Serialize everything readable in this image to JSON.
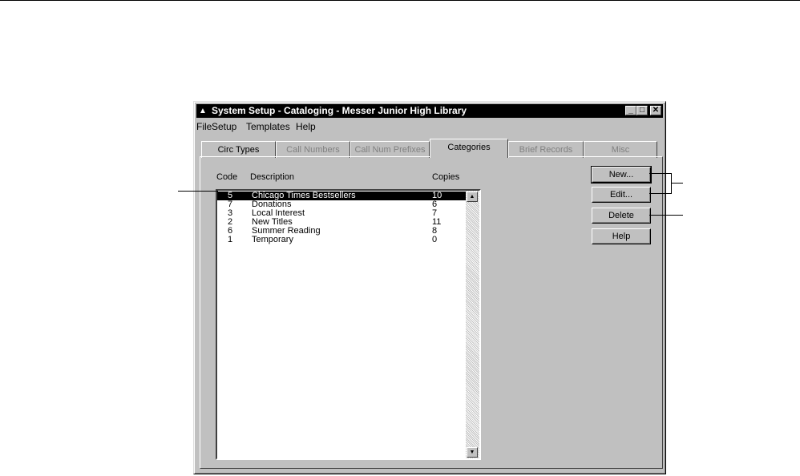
{
  "window": {
    "title": "System Setup - Cataloging - Messer Junior High Library",
    "minimize_glyph": "_",
    "maximize_glyph": "□",
    "close_glyph": "✕"
  },
  "menu": [
    "File",
    "Setup",
    "Templates",
    "Help"
  ],
  "tabs": [
    {
      "label": "Circ Types",
      "disabled": false
    },
    {
      "label": "Call Numbers",
      "disabled": true
    },
    {
      "label": "Call Num Prefixes",
      "disabled": true
    },
    {
      "label": "Categories",
      "disabled": false,
      "active": true
    },
    {
      "label": "Brief Records",
      "disabled": true
    },
    {
      "label": "Misc",
      "disabled": true
    }
  ],
  "list": {
    "headers": {
      "code": "Code",
      "description": "Description",
      "copies": "Copies"
    },
    "rows": [
      {
        "code": "5",
        "description": "Chicago Times Bestsellers",
        "copies": "10",
        "selected": true
      },
      {
        "code": "7",
        "description": "Donations",
        "copies": "6"
      },
      {
        "code": "3",
        "description": "Local Interest",
        "copies": "7"
      },
      {
        "code": "2",
        "description": "New Titles",
        "copies": "11"
      },
      {
        "code": "6",
        "description": "Summer Reading",
        "copies": "8"
      },
      {
        "code": "1",
        "description": "Temporary",
        "copies": "0"
      }
    ]
  },
  "buttons": {
    "new": "New...",
    "edit": "Edit...",
    "delete": "Delete",
    "help": "Help"
  },
  "icons": {
    "scroll_up": "scroll-up-arrow-icon",
    "scroll_down": "scroll-down-arrow-icon",
    "app": "app-icon"
  }
}
